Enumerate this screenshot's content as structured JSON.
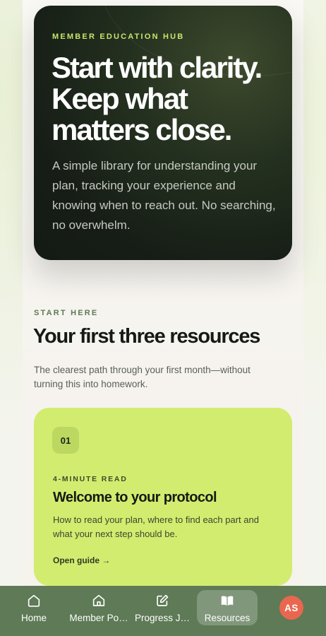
{
  "hero": {
    "eyebrow": "MEMBER EDUCATION HUB",
    "title_lines": [
      "Start with clarity.",
      "Keep what",
      "matters close."
    ],
    "description": "A simple library for understanding your plan, tracking your experience and knowing when to reach out. No searching, no overwhelm."
  },
  "section": {
    "eyebrow": "START HERE",
    "title": "Your first three resources",
    "description": "The clearest path through your first month—without turning this into homework."
  },
  "resources": [
    {
      "number": "01",
      "meta": "4-MINUTE READ",
      "title": "Welcome to your protocol",
      "description": "How to read your plan, where to find each part and what your next step should be.",
      "link": "Open guide →"
    }
  ],
  "nav": {
    "items": [
      {
        "label": "Home",
        "icon": "home-icon"
      },
      {
        "label": "Member Po…",
        "icon": "house-icon"
      },
      {
        "label": "Progress J…",
        "icon": "edit-icon"
      },
      {
        "label": "Resources",
        "icon": "book-icon",
        "active": true
      }
    ],
    "avatar_initials": "AS"
  },
  "colors": {
    "accent_lime": "#d2ec6f",
    "nav_green": "#5e7a56",
    "avatar": "#e9674f",
    "hero_dark": "#161d16"
  }
}
